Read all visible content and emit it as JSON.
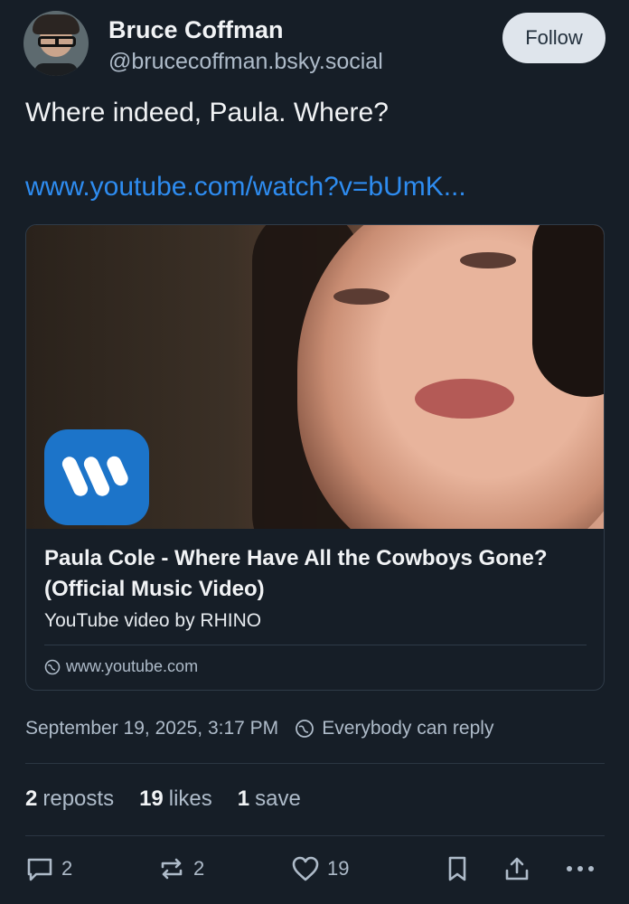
{
  "author": {
    "name": "Bruce Coffman",
    "handle": "@brucecoffman.bsky.social",
    "follow_label": "Follow"
  },
  "post": {
    "text": "Where indeed, Paula. Where?",
    "link_text": "www.youtube.com/watch?v=bUmK..."
  },
  "embed": {
    "title": "Paula Cole - Where Have All the Cowboys Gone? (Official Music Video)",
    "subtitle": "YouTube video by RHINO",
    "domain": "www.youtube.com",
    "logo_color": "#1c74c9"
  },
  "meta": {
    "timestamp": "September 19, 2025, 3:17 PM",
    "reply_setting": "Everybody can reply"
  },
  "stats": {
    "reposts_count": "2",
    "reposts_label": "reposts",
    "likes_count": "19",
    "likes_label": "likes",
    "saves_count": "1",
    "saves_label": "save"
  },
  "actions": {
    "reply_count": "2",
    "repost_count": "2",
    "like_count": "19"
  },
  "colors": {
    "background": "#161e27",
    "link": "#2e8cf0",
    "muted_text": "#aebbc9"
  }
}
